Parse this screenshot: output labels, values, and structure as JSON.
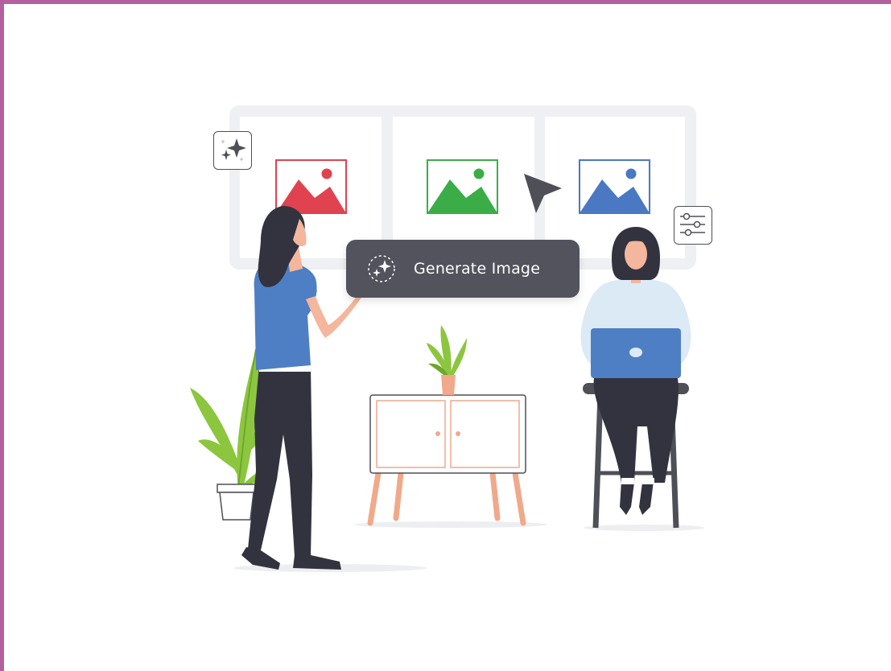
{
  "action_button": {
    "label": "Generate Image",
    "icon": "sparkle-icon"
  },
  "gallery": {
    "cards": [
      {
        "icon": "image-icon",
        "color": "#e0424f"
      },
      {
        "icon": "image-icon",
        "color": "#3aad47"
      },
      {
        "icon": "image-icon",
        "color": "#4a78c2"
      }
    ]
  },
  "floating_icons": [
    "sparkle-icon",
    "sliders-icon",
    "cursor-arrow-icon"
  ],
  "colors": {
    "frame": "#b45f9e",
    "button_bg": "#52535c",
    "panel_bg": "#eef0f3",
    "plant_green": "#8cc63f",
    "shirt_blue": "#4e7fc4",
    "skin": "#f4b69c",
    "pants": "#33333f",
    "hair": "#33333f",
    "furniture_peach": "#f0a98a"
  }
}
